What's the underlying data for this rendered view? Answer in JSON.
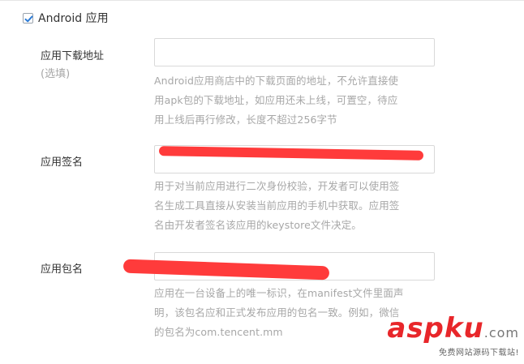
{
  "platform": {
    "checkbox_label": "Android 应用",
    "checked": true
  },
  "fields": {
    "download_url": {
      "label": "应用下载地址",
      "optional": "(选填)",
      "value": "",
      "help_lines": [
        "Android应用商店中的下载页面的地址，不允许直接使",
        "用apk包的下载地址，如应用还未上线，可置空，待应",
        "用上线后再行修改，长度不超过256字节"
      ]
    },
    "signature": {
      "label": "应用签名",
      "value": "",
      "help_lines": [
        "用于对当前应用进行二次身份校验，开发者可以使用签",
        "名生成工具直接从安装当前应用的手机中获取。应用签",
        "名由开发者签名该应用的keystore文件决定。"
      ]
    },
    "package_name": {
      "label": "应用包名",
      "value": "",
      "help_lines": [
        "应用在一台设备上的唯一标识，在manifest文件里面声",
        "明，该包名应和正式发布应用的包名一致。例如，微信",
        "的包名为com.tencent.mm"
      ]
    }
  },
  "watermark": {
    "asp": "asp",
    "ku": "ku",
    "dotcom": ".com",
    "tagline": "免费网站源码下载站!"
  },
  "colors": {
    "accent": "#2b7bd6",
    "redaction": "#ff3b3b",
    "help_text": "#a7a7a7"
  }
}
